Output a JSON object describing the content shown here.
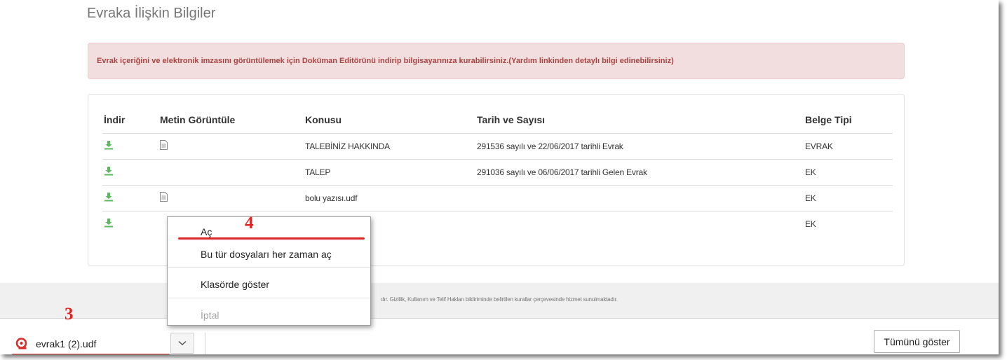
{
  "section": {
    "title": "Evraka İlişkin Bilgiler"
  },
  "alert": {
    "text": "Evrak içeriğini ve elektronik imzasını görüntülemek için Doküman Editörünü indirip bilgisayarınıza kurabilirsiniz.(Yardım linkinden detaylı bilgi edinebilirsiniz)"
  },
  "table": {
    "headers": [
      "İndir",
      "Metin Görüntüle",
      "Konusu",
      "Tarih ve Sayısı",
      "Belge Tipi"
    ],
    "rows": [
      {
        "konu": "TALEBİNİZ HAKKINDA",
        "tarih": "291536 sayılı ve 22/06/2017 tarihli Evrak",
        "tip": "EVRAK",
        "has_text_icon": true
      },
      {
        "konu": "TALEP",
        "tarih": "291036 sayılı ve 06/06/2017 tarihli Gelen Evrak",
        "tip": "EK",
        "has_text_icon": false
      },
      {
        "konu": "bolu yazısı.udf",
        "tarih": "",
        "tip": "EK",
        "has_text_icon": true
      },
      {
        "konu": "",
        "tarih": "",
        "tip": "EK",
        "has_text_icon": false
      }
    ]
  },
  "footer": {
    "text": "dır. Gizlilik, Kullanım ve Telif Hakları bildiriminde belirtilen kurallar çerçevesinde hizmet sunulmaktadır."
  },
  "context_menu": {
    "items": [
      "Aç",
      "Bu tür dosyaları her zaman aç",
      "Klasörde göster",
      "İptal"
    ]
  },
  "download_bar": {
    "file_name": "evrak1 (2).udf",
    "show_all_label": "Tümünü göster"
  },
  "annotations": {
    "step3": "3",
    "step4": "4"
  },
  "colors": {
    "download_icon": "#5cb85c",
    "alert_bg": "#f2dede",
    "alert_text": "#a94442",
    "annotation_red": "#e02424"
  },
  "icons": {
    "download": "download-icon",
    "text_view": "file-text-icon",
    "file_type": "udf-file-icon",
    "chevron": "chevron-down-icon"
  }
}
